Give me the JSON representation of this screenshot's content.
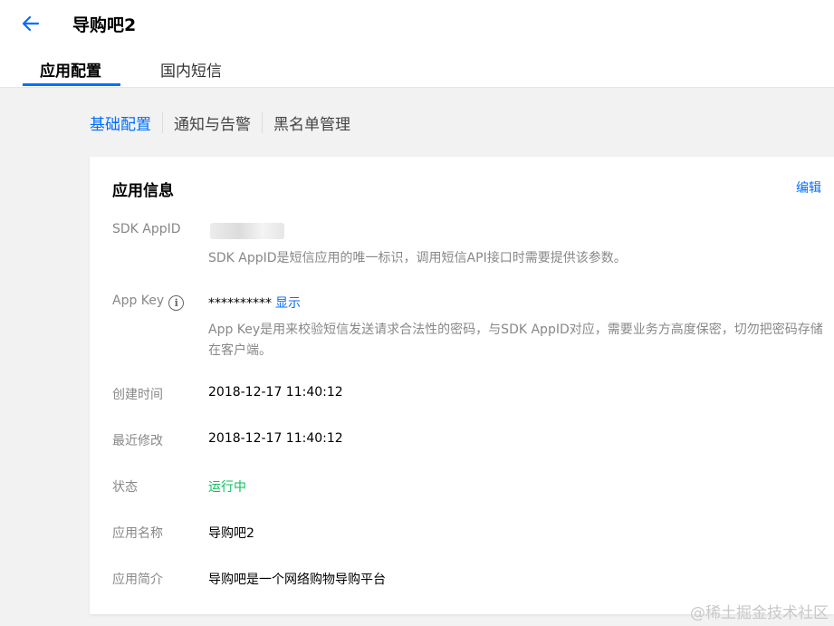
{
  "header": {
    "title": "导购吧2",
    "tabs": [
      {
        "label": "应用配置"
      },
      {
        "label": "国内短信"
      }
    ]
  },
  "subnav": {
    "items": [
      "基础配置",
      "通知与告警",
      "黑名单管理"
    ]
  },
  "card": {
    "title": "应用信息",
    "edit_label": "编辑",
    "sdk_appid": {
      "label": "SDK AppID",
      "desc": "SDK AppID是短信应用的唯一标识，调用短信API接口时需要提供该参数。"
    },
    "app_key": {
      "label": "App Key",
      "info_icon": "i",
      "value": "**********",
      "show_label": "显示",
      "desc": "App Key是用来校验短信发送请求合法性的密码，与SDK AppID对应，需要业务方高度保密，切勿把密码存储在客户端。"
    },
    "created": {
      "label": "创建时间",
      "value": "2018-12-17 11:40:12"
    },
    "modified": {
      "label": "最近修改",
      "value": "2018-12-17 11:40:12"
    },
    "status": {
      "label": "状态",
      "value": "运行中",
      "color": "#0abf5b"
    },
    "app_name": {
      "label": "应用名称",
      "value": "导购吧2"
    },
    "app_intro": {
      "label": "应用简介",
      "value": "导购吧是一个网络购物导购平台"
    }
  },
  "watermark": "@稀土掘金技术社区",
  "colors": {
    "accent": "#006eff",
    "status_green": "#0abf5b"
  }
}
